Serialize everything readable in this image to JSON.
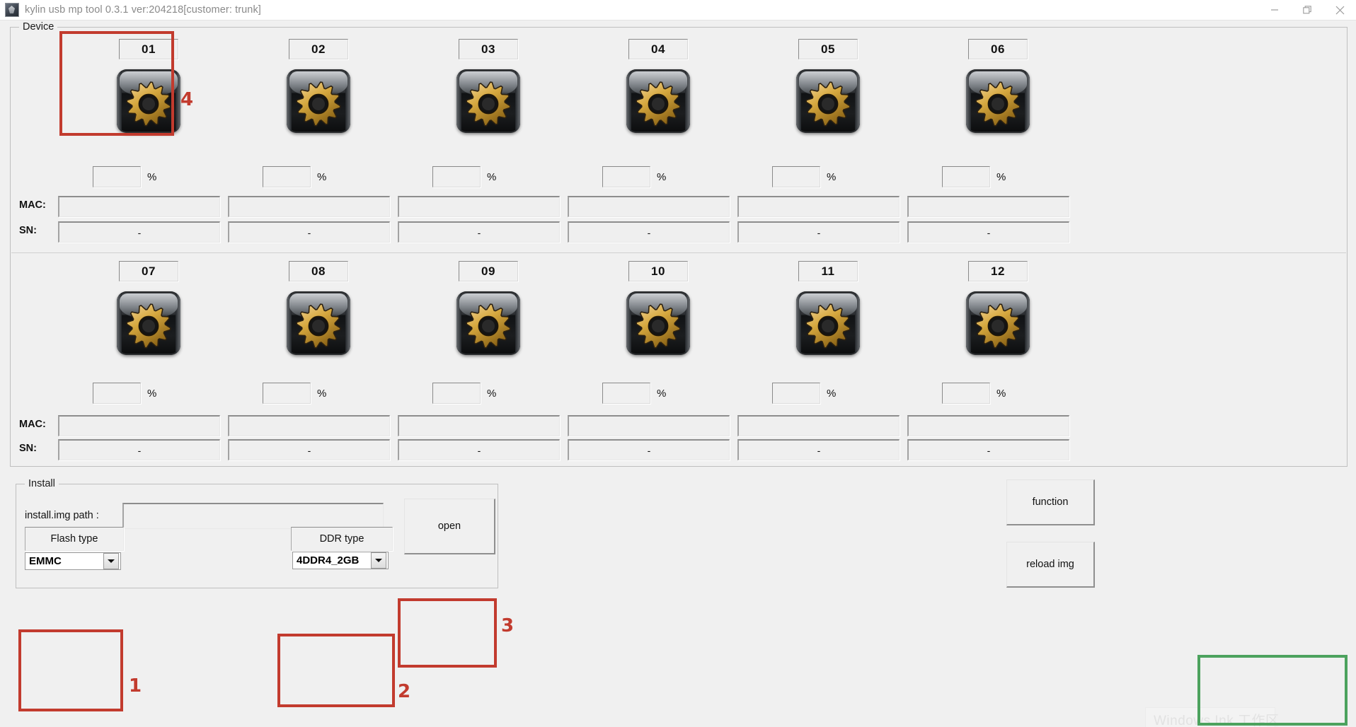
{
  "window": {
    "title": "kylin usb mp tool 0.3.1 ver:204218[customer: trunk]",
    "icon": "app-icon",
    "controls": {
      "minimize": "minimize-icon",
      "maximize": "restore-icon",
      "close": "close-icon"
    }
  },
  "device_group": {
    "title": "Device",
    "row_labels": {
      "mac": "MAC:",
      "sn": "SN:"
    },
    "percent_symbol": "%",
    "devices": [
      {
        "number": "01",
        "icon": "gear-icon",
        "percent": "",
        "mac": "",
        "sn": "-"
      },
      {
        "number": "02",
        "icon": "gear-icon",
        "percent": "",
        "mac": "",
        "sn": "-"
      },
      {
        "number": "03",
        "icon": "gear-icon",
        "percent": "",
        "mac": "",
        "sn": "-"
      },
      {
        "number": "04",
        "icon": "gear-icon",
        "percent": "",
        "mac": "",
        "sn": "-"
      },
      {
        "number": "05",
        "icon": "gear-icon",
        "percent": "",
        "mac": "",
        "sn": "-"
      },
      {
        "number": "06",
        "icon": "gear-icon",
        "percent": "",
        "mac": "",
        "sn": "-"
      },
      {
        "number": "07",
        "icon": "gear-icon",
        "percent": "",
        "mac": "",
        "sn": "-"
      },
      {
        "number": "08",
        "icon": "gear-icon",
        "percent": "",
        "mac": "",
        "sn": "-"
      },
      {
        "number": "09",
        "icon": "gear-icon",
        "percent": "",
        "mac": "",
        "sn": "-"
      },
      {
        "number": "10",
        "icon": "gear-icon",
        "percent": "",
        "mac": "",
        "sn": "-"
      },
      {
        "number": "11",
        "icon": "gear-icon",
        "percent": "",
        "mac": "",
        "sn": "-"
      },
      {
        "number": "12",
        "icon": "gear-icon",
        "percent": "",
        "mac": "",
        "sn": "-"
      }
    ]
  },
  "install_group": {
    "title": "Install",
    "path_label": "install.img path :",
    "path_value": "",
    "flash_type_label": "Flash type",
    "flash_type_value": "EMMC",
    "ddr_type_label": "DDR type",
    "ddr_type_value": "4DDR4_2GB",
    "open_button": "open"
  },
  "side_buttons": {
    "function": "function",
    "reload_img": "reload img"
  },
  "annotations": {
    "color_red": "#c23b2e",
    "color_green": "#4ca25e",
    "labels": {
      "one": "1",
      "two": "2",
      "three": "3",
      "four": "4"
    }
  },
  "watermark": {
    "text": "Windows Ink 工作区"
  }
}
